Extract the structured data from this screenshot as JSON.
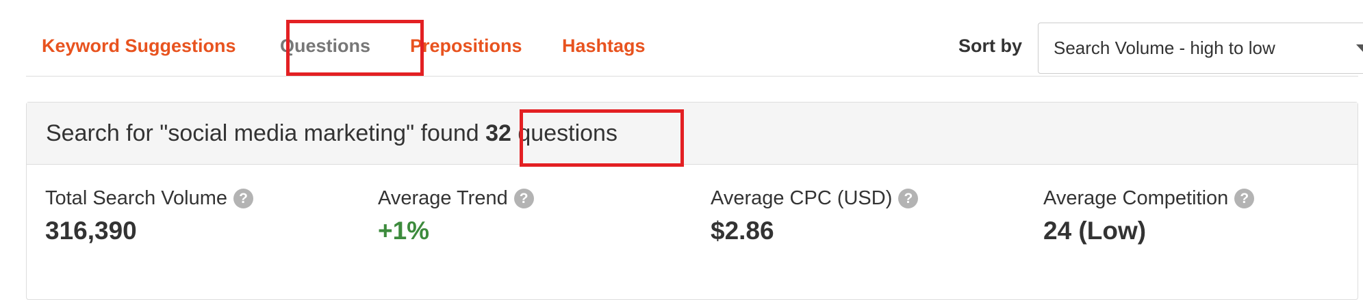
{
  "tabs": [
    {
      "label": "Keyword Suggestions",
      "active": false
    },
    {
      "label": "Questions",
      "active": true
    },
    {
      "label": "Prepositions",
      "active": false
    },
    {
      "label": "Hashtags",
      "active": false
    }
  ],
  "sort": {
    "label": "Sort by",
    "value": "Search Volume - high to low"
  },
  "summary": {
    "prefix": "Search for \"social media marketing\" found ",
    "count": "32",
    "suffix": " questions"
  },
  "metrics": [
    {
      "label": "Total Search Volume",
      "value": "316,390"
    },
    {
      "label": "Average Trend",
      "value": "+1%"
    },
    {
      "label": "Average CPC (USD)",
      "value": "$2.86"
    },
    {
      "label": "Average Competition",
      "value": "24 (Low)"
    }
  ],
  "icons": {
    "help": "question-mark-circle",
    "dropdown": "chevron-down"
  },
  "colors": {
    "tab_accent": "#e8531f",
    "tab_active": "#777777",
    "highlight": "#e32023",
    "positive": "#3d8b3d"
  }
}
